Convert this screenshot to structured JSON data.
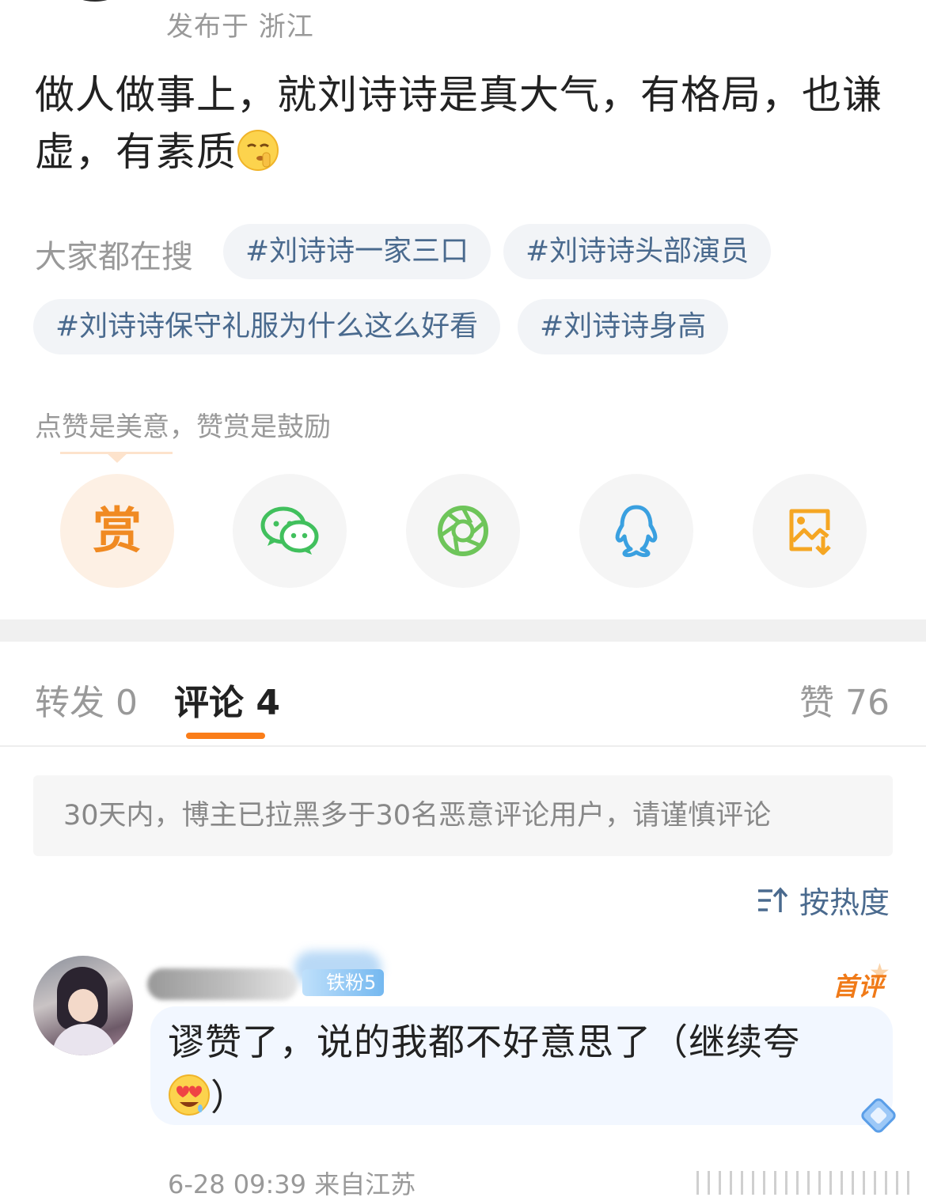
{
  "post": {
    "publish_meta": "发布于 浙江",
    "text_part1": "做人做事上，就刘诗诗是真大气，有格局，也谦虚，有素质",
    "emoji_icon": "shushing-face-icon"
  },
  "hot_search": {
    "label": "大家都在搜",
    "tags": [
      "#刘诗诗一家三口",
      "#刘诗诗头部演员",
      "#刘诗诗保守礼服为什么这么好看",
      "#刘诗诗身高"
    ]
  },
  "reward": {
    "hint": "点赞是美意，赞赏是鼓励",
    "button_label": "赏"
  },
  "share": {
    "items": [
      "wechat-icon",
      "moments-icon",
      "qq-icon",
      "save-image-icon"
    ]
  },
  "tabs": {
    "repost": "转发 0",
    "comment": "评论 4",
    "like": "赞 76"
  },
  "notice": "30天内，博主已拉黑多于30名恶意评论用户，请谨慎评论",
  "sort": {
    "label": "按热度"
  },
  "comment": {
    "fan_badge": "铁粉5",
    "first_label": "首评",
    "text": "谬赞了，说的我都不好意思了（继续夸",
    "text_end": "）",
    "meta": "6-28 09:39 来自江苏"
  },
  "colors": {
    "accent": "#fa7d19",
    "link": "#4a6a8e",
    "wechat": "#41c05d",
    "moments": "#6ec55a",
    "qq": "#3aa0e0",
    "save": "#f5a623"
  }
}
